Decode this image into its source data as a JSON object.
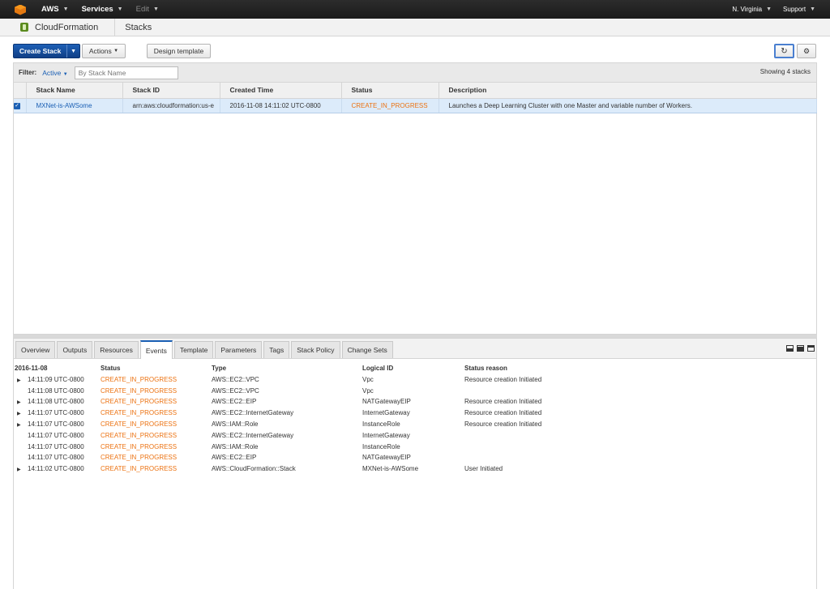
{
  "topnav": {
    "brand": "AWS",
    "services": "Services",
    "edit": "Edit",
    "region": "N. Virginia",
    "support": "Support"
  },
  "servicebar": {
    "service": "CloudFormation",
    "page": "Stacks"
  },
  "toolbar": {
    "create_stack": "Create Stack",
    "actions": "Actions",
    "design_template": "Design template",
    "refresh_glyph": "↻",
    "settings_glyph": "⚙"
  },
  "filter": {
    "label": "Filter:",
    "active": "Active",
    "placeholder": "By Stack Name",
    "showing": "Showing 4 stacks"
  },
  "stacks_table": {
    "columns": [
      "Stack Name",
      "Stack ID",
      "Created Time",
      "Status",
      "Description"
    ],
    "rows": [
      {
        "selected": true,
        "name": "MXNet-is-AWSome",
        "stack_id": "arn:aws:cloudformation:us-e",
        "created": "2016-11-08 14:11:02 UTC-0800",
        "status": "CREATE_IN_PROGRESS",
        "description": "Launches a Deep Learning Cluster with one Master and variable number of Workers."
      }
    ]
  },
  "detail_tabs": [
    "Overview",
    "Outputs",
    "Resources",
    "Events",
    "Template",
    "Parameters",
    "Tags",
    "Stack Policy",
    "Change Sets"
  ],
  "active_tab": "Events",
  "events": {
    "date": "2016-11-08",
    "columns": {
      "status": "Status",
      "type": "Type",
      "logical_id": "Logical ID",
      "reason": "Status reason"
    },
    "rows": [
      {
        "expand": true,
        "time": "14:11:09 UTC-0800",
        "status": "CREATE_IN_PROGRESS",
        "type": "AWS::EC2::VPC",
        "logical_id": "Vpc",
        "reason": "Resource creation Initiated"
      },
      {
        "expand": false,
        "time": "14:11:08 UTC-0800",
        "status": "CREATE_IN_PROGRESS",
        "type": "AWS::EC2::VPC",
        "logical_id": "Vpc",
        "reason": ""
      },
      {
        "expand": true,
        "time": "14:11:08 UTC-0800",
        "status": "CREATE_IN_PROGRESS",
        "type": "AWS::EC2::EIP",
        "logical_id": "NATGatewayEIP",
        "reason": "Resource creation Initiated"
      },
      {
        "expand": true,
        "time": "14:11:07 UTC-0800",
        "status": "CREATE_IN_PROGRESS",
        "type": "AWS::EC2::InternetGateway",
        "logical_id": "InternetGateway",
        "reason": "Resource creation Initiated"
      },
      {
        "expand": true,
        "time": "14:11:07 UTC-0800",
        "status": "CREATE_IN_PROGRESS",
        "type": "AWS::IAM::Role",
        "logical_id": "InstanceRole",
        "reason": "Resource creation Initiated"
      },
      {
        "expand": false,
        "time": "14:11:07 UTC-0800",
        "status": "CREATE_IN_PROGRESS",
        "type": "AWS::EC2::InternetGateway",
        "logical_id": "InternetGateway",
        "reason": ""
      },
      {
        "expand": false,
        "time": "14:11:07 UTC-0800",
        "status": "CREATE_IN_PROGRESS",
        "type": "AWS::IAM::Role",
        "logical_id": "InstanceRole",
        "reason": ""
      },
      {
        "expand": false,
        "time": "14:11:07 UTC-0800",
        "status": "CREATE_IN_PROGRESS",
        "type": "AWS::EC2::EIP",
        "logical_id": "NATGatewayEIP",
        "reason": ""
      },
      {
        "expand": true,
        "time": "14:11:02 UTC-0800",
        "status": "CREATE_IN_PROGRESS",
        "type": "AWS::CloudFormation::Stack",
        "logical_id": "MXNet-is-AWSome",
        "reason": "User Initiated"
      }
    ]
  },
  "colors": {
    "status_in_progress": "#ec7211",
    "link": "#1a5fb4",
    "primary_button": "#1d5fb5"
  }
}
